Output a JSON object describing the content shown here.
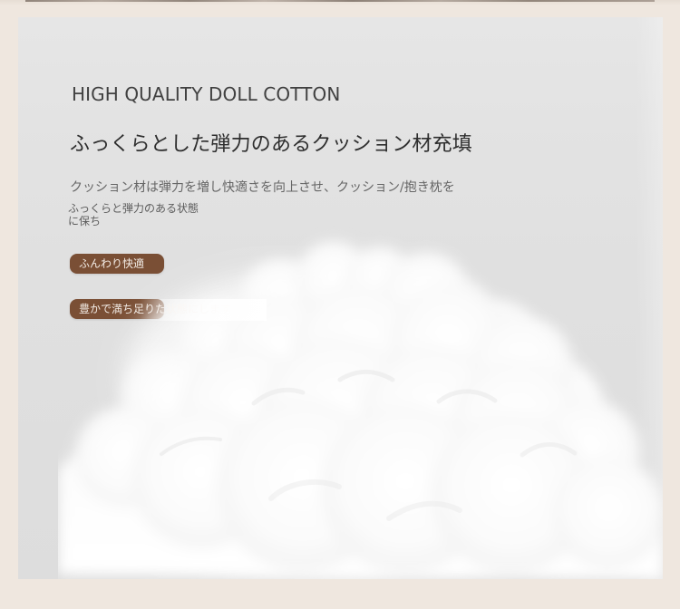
{
  "product": {
    "headline_en": "HIGH QUALITY DOLL COTTON",
    "headline_jp": "ふっくらとした弾力のあるクッション材充填",
    "description_line_1": "クッション材は弾力を増し快適さを向上させ、クッション/抱き枕を",
    "description_line_2": "ふっくらと弾力のある状態",
    "description_line_3": "に保ち"
  },
  "tags": [
    {
      "label": "ふんわり快適"
    },
    {
      "label": "豊かで満ち足りた状態にします"
    }
  ],
  "colors": {
    "background": "#efe7df",
    "panel": "#e2e2e2",
    "tag": "#7a4f35",
    "headline": "#2e2e2e"
  }
}
